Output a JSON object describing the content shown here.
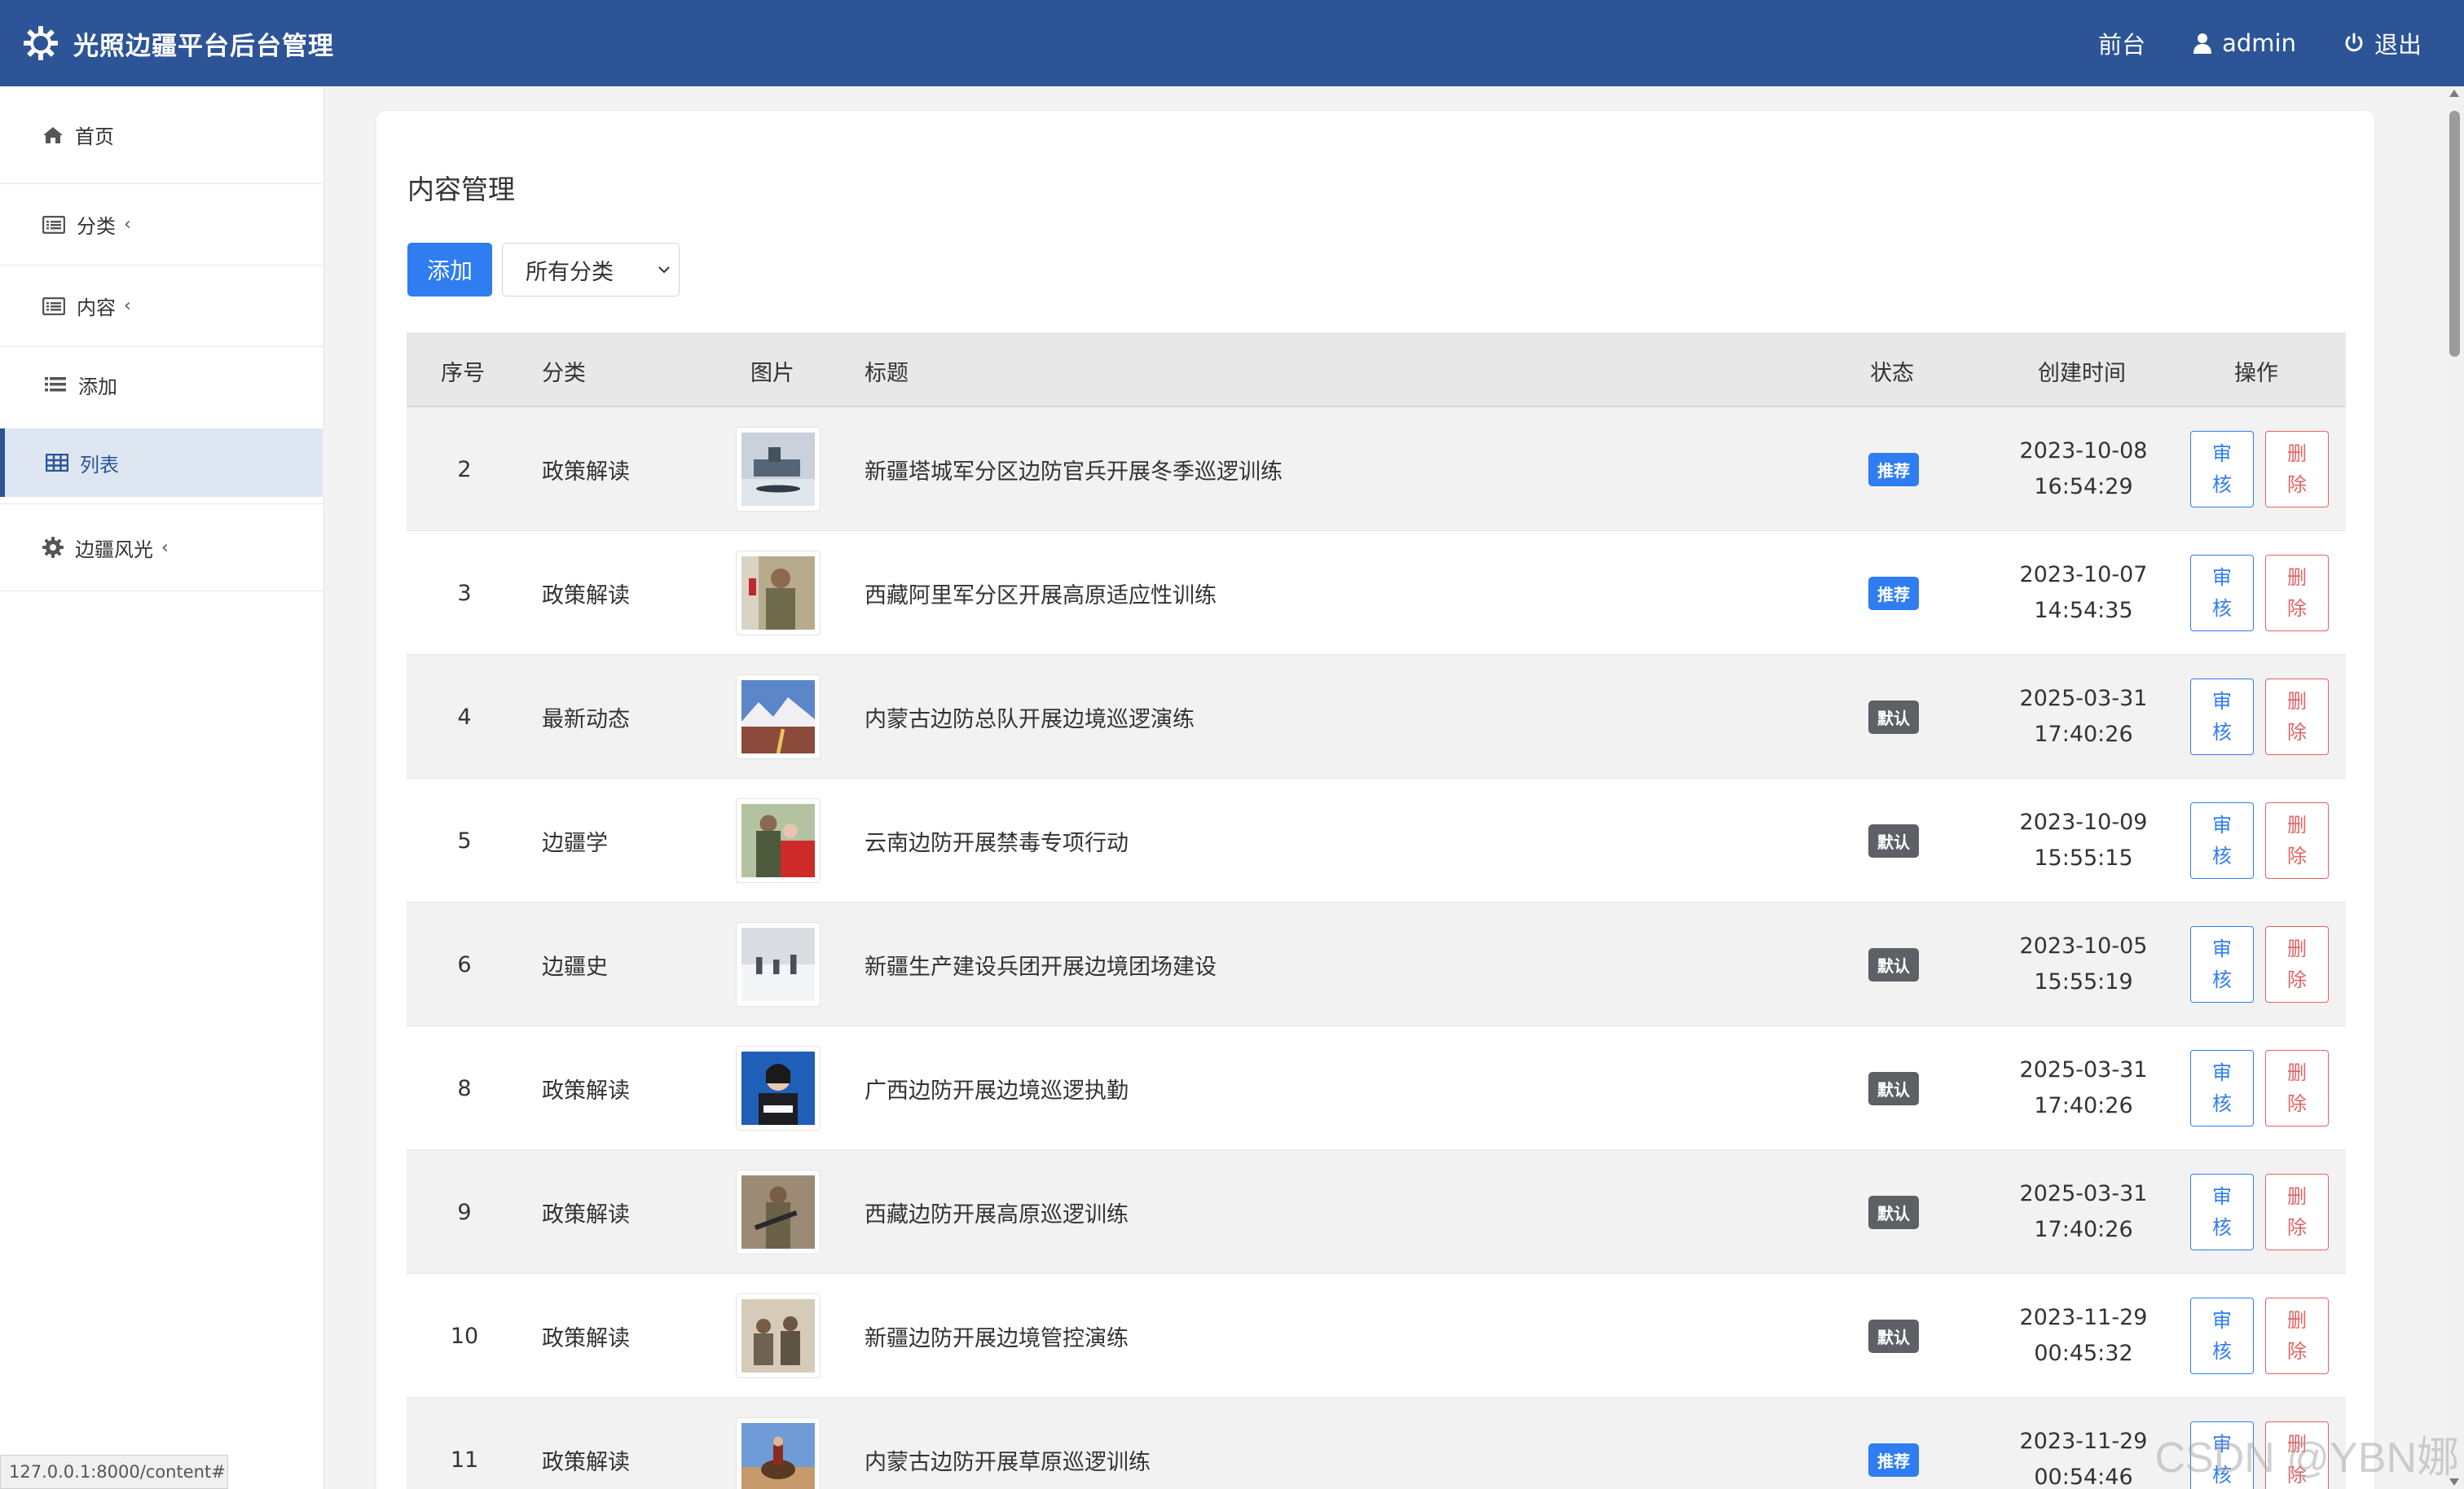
{
  "header": {
    "title": "光照边疆平台后台管理",
    "front_label": "前台",
    "user_label": "admin",
    "logout_label": "退出"
  },
  "sidebar": {
    "items": [
      {
        "label": "首页",
        "icon": "home-icon"
      },
      {
        "label": "分类",
        "icon": "list-alt-icon",
        "caret": "‹"
      },
      {
        "label": "内容",
        "icon": "list-alt-icon",
        "caret": "‹"
      },
      {
        "label": "添加",
        "icon": "bars-icon"
      },
      {
        "label": "列表",
        "icon": "table-icon"
      },
      {
        "label": "边疆风光",
        "icon": "gear-icon",
        "caret": "‹"
      }
    ]
  },
  "page": {
    "title": "内容管理",
    "add_label": "添加",
    "category_filter": "所有分类"
  },
  "table": {
    "headers": [
      "序号",
      "分类",
      "图片",
      "标题",
      "状态",
      "创建时间",
      "操作"
    ],
    "rows": [
      {
        "id": "2",
        "category": "政策解读",
        "title": "新疆塔城军分区边防官兵开展冬季巡逻训练",
        "status": "推荐",
        "date": "2023-10-08",
        "time": "16:54:29",
        "image": "ship-on-ice"
      },
      {
        "id": "3",
        "category": "政策解读",
        "title": "西藏阿里军分区开展高原适应性训练",
        "status": "推荐",
        "date": "2023-10-07",
        "time": "14:54:35",
        "image": "soldier-portrait"
      },
      {
        "id": "4",
        "category": "最新动态",
        "title": "内蒙古边防总队开展边境巡逻演练",
        "status": "默认",
        "date": "2025-03-31",
        "time": "17:40:26",
        "image": "mountain-road"
      },
      {
        "id": "5",
        "category": "边疆学",
        "title": "云南边防开展禁毒专项行动",
        "status": "默认",
        "date": "2023-10-09",
        "time": "15:55:15",
        "image": "soldier-with-flag"
      },
      {
        "id": "6",
        "category": "边疆史",
        "title": "新疆生产建设兵团开展边境团场建设",
        "status": "默认",
        "date": "2023-10-05",
        "time": "15:55:19",
        "image": "snow-patrol"
      },
      {
        "id": "8",
        "category": "政策解读",
        "title": "广西边防开展边境巡逻执勤",
        "status": "默认",
        "date": "2025-03-31",
        "time": "17:40:26",
        "image": "press-speaker"
      },
      {
        "id": "9",
        "category": "政策解读",
        "title": "西藏边防开展高原巡逻训练",
        "status": "默认",
        "date": "2025-03-31",
        "time": "17:40:26",
        "image": "soldier-rifle"
      },
      {
        "id": "10",
        "category": "政策解读",
        "title": "新疆边防开展边境管控演练",
        "status": "默认",
        "date": "2023-11-29",
        "time": "00:45:32",
        "image": "desert-patrol"
      },
      {
        "id": "11",
        "category": "政策解读",
        "title": "内蒙古边防开展草原巡逻训练",
        "status": "推荐",
        "date": "2023-11-29",
        "time": "00:54:46",
        "image": "horse-rider"
      }
    ],
    "review_label": [
      "审",
      "核"
    ],
    "delete_label": [
      "删",
      "除"
    ]
  },
  "status_colors": {
    "推荐": "#2f7df1",
    "默认": "#5f6066"
  },
  "browser": {
    "status_url": "127.0.0.1:8000/content#"
  },
  "watermark": "CSDN @YBN娜",
  "colors": {
    "header_bg": "#2c5497",
    "primary": "#2f7df1",
    "danger": "#e26363"
  }
}
